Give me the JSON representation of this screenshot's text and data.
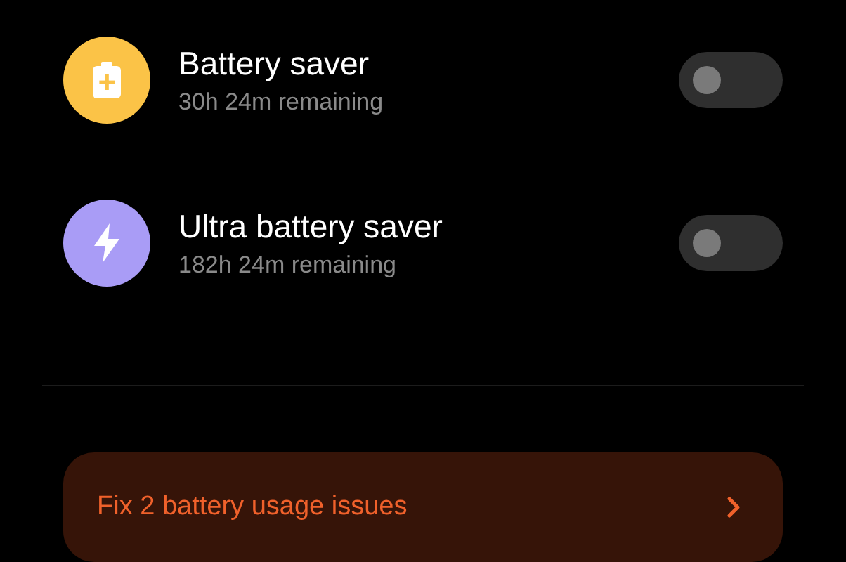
{
  "modes": [
    {
      "kind": "battery",
      "title": "Battery saver",
      "subtitle": "30h 24m remaining",
      "color": "#fbc347",
      "on": false
    },
    {
      "kind": "bolt",
      "title": "Ultra battery saver",
      "subtitle": "182h 24m remaining",
      "color": "#a99cf6",
      "on": false
    }
  ],
  "banner": {
    "label": "Fix 2 battery usage issues"
  }
}
